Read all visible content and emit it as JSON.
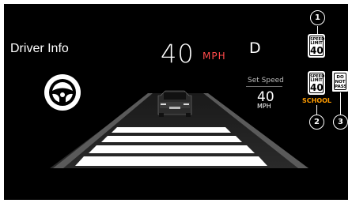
{
  "header": {
    "title": "Driver Info",
    "speed": "40",
    "speed_unit": "MPH",
    "gear": "D"
  },
  "set_speed": {
    "label": "Set Speed",
    "value": "40",
    "unit": "MPH"
  },
  "signs": {
    "speed_limit": {
      "line1": "SPEED",
      "line2": "LIMIT",
      "value": "40"
    },
    "school_limit": {
      "line1": "SPEED",
      "line2": "LIMIT",
      "value": "40",
      "caption": "SCHOOL"
    },
    "do_not_pass": {
      "line1": "DO",
      "line2": "NOT",
      "line3": "PASS"
    }
  },
  "callouts": [
    "1",
    "2",
    "3"
  ],
  "colors": {
    "background": "#000000",
    "unit_red": "#ff4a4a",
    "school_orange": "#ff9c00",
    "road_stripe": "#ffffff"
  },
  "icons": {
    "steering": "steering-wheel-icon",
    "vehicle": "lead-vehicle-icon"
  }
}
